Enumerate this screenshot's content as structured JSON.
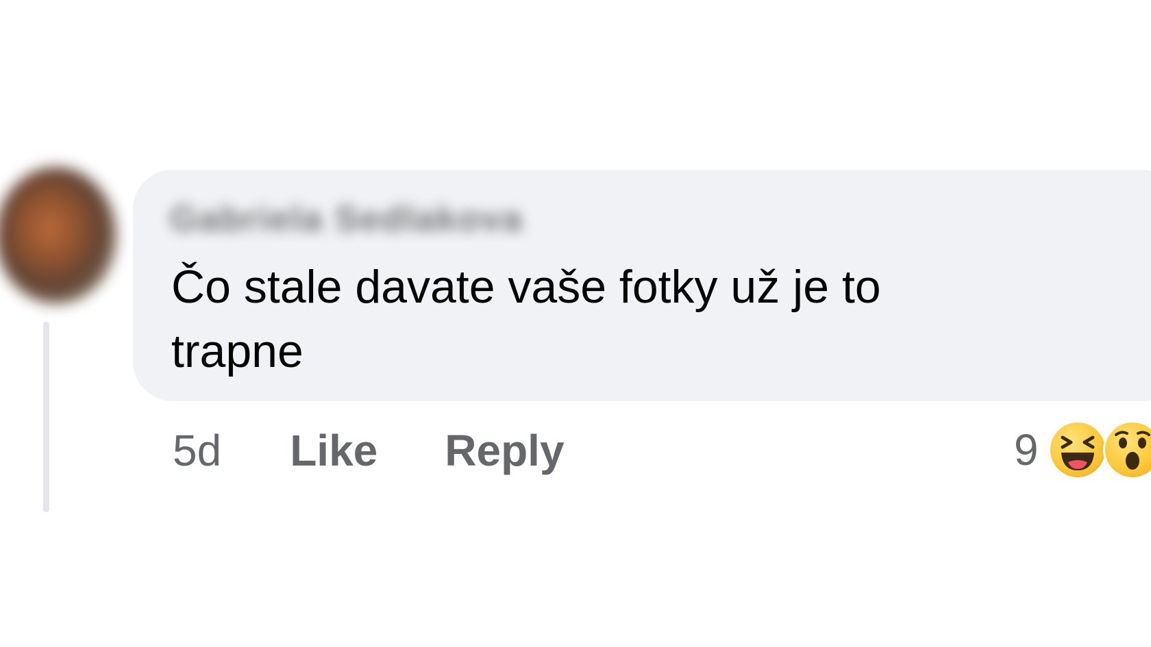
{
  "comment": {
    "author": "Gabriela Sedlakova",
    "text": "Čo stale davate vaše fotky už je to trapne",
    "timestamp": "5d",
    "like_label": "Like",
    "reply_label": "Reply",
    "reaction_count": "9",
    "reactions": [
      "laughing-emoji-icon",
      "wow-emoji-icon"
    ]
  },
  "colors": {
    "bubble": "#f0f2f5",
    "text": "#050505",
    "meta": "#65676b",
    "thread_line": "#e4e6e9"
  }
}
